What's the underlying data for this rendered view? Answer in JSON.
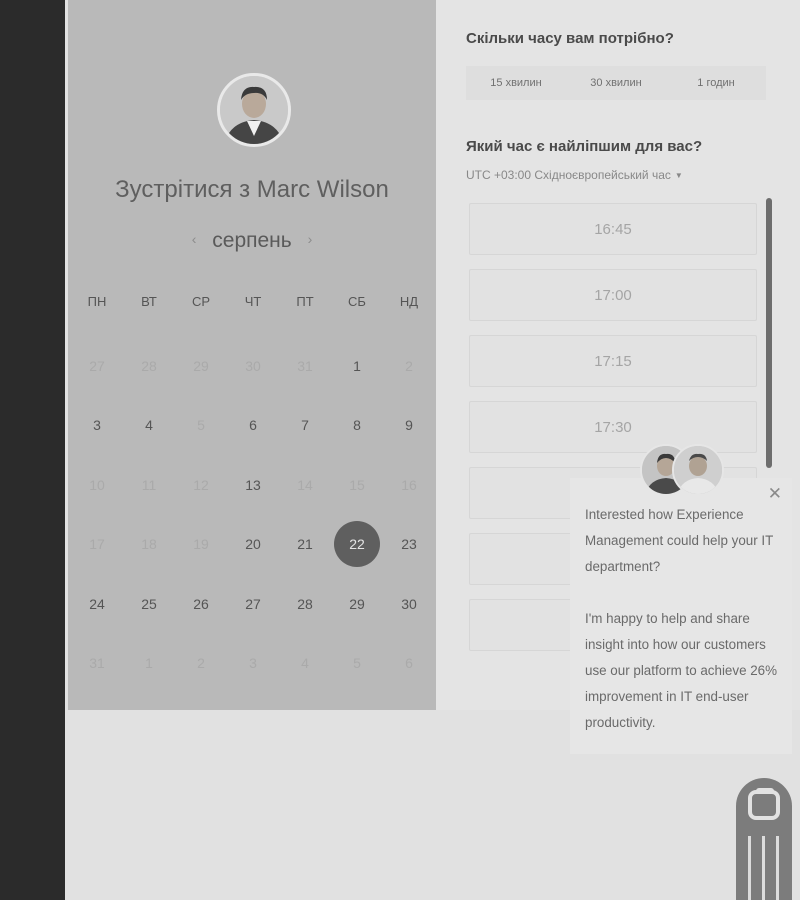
{
  "host": {
    "title": "Зустрітися з Marc Wilson"
  },
  "calendar": {
    "month": "серпень",
    "weekdays": [
      "ПН",
      "ВТ",
      "СР",
      "ЧТ",
      "ПТ",
      "СБ",
      "НД"
    ],
    "days": [
      {
        "label": "27",
        "state": "inactive"
      },
      {
        "label": "28",
        "state": "inactive"
      },
      {
        "label": "29",
        "state": "inactive"
      },
      {
        "label": "30",
        "state": "inactive"
      },
      {
        "label": "31",
        "state": "inactive"
      },
      {
        "label": "1",
        "state": "active"
      },
      {
        "label": "2",
        "state": "inactive"
      },
      {
        "label": "3",
        "state": "active"
      },
      {
        "label": "4",
        "state": "active"
      },
      {
        "label": "5",
        "state": "inactive"
      },
      {
        "label": "6",
        "state": "active"
      },
      {
        "label": "7",
        "state": "active"
      },
      {
        "label": "8",
        "state": "active"
      },
      {
        "label": "9",
        "state": "active"
      },
      {
        "label": "10",
        "state": "inactive"
      },
      {
        "label": "11",
        "state": "inactive"
      },
      {
        "label": "12",
        "state": "inactive"
      },
      {
        "label": "13",
        "state": "active"
      },
      {
        "label": "14",
        "state": "inactive"
      },
      {
        "label": "15",
        "state": "inactive"
      },
      {
        "label": "16",
        "state": "inactive"
      },
      {
        "label": "17",
        "state": "inactive"
      },
      {
        "label": "18",
        "state": "inactive"
      },
      {
        "label": "19",
        "state": "inactive"
      },
      {
        "label": "20",
        "state": "active"
      },
      {
        "label": "21",
        "state": "active"
      },
      {
        "label": "22",
        "state": "selected"
      },
      {
        "label": "23",
        "state": "active"
      },
      {
        "label": "24",
        "state": "active"
      },
      {
        "label": "25",
        "state": "active"
      },
      {
        "label": "26",
        "state": "active"
      },
      {
        "label": "27",
        "state": "active"
      },
      {
        "label": "28",
        "state": "active"
      },
      {
        "label": "29",
        "state": "active"
      },
      {
        "label": "30",
        "state": "active"
      },
      {
        "label": "31",
        "state": "inactive"
      },
      {
        "label": "1",
        "state": "inactive"
      },
      {
        "label": "2",
        "state": "inactive"
      },
      {
        "label": "3",
        "state": "inactive"
      },
      {
        "label": "4",
        "state": "inactive"
      },
      {
        "label": "5",
        "state": "inactive"
      },
      {
        "label": "6",
        "state": "inactive"
      }
    ]
  },
  "duration": {
    "question": "Скільки часу вам потрібно?",
    "options": [
      "15 хвилин",
      "30 хвилин",
      "1 годин"
    ]
  },
  "time": {
    "question": "Який час є найліпшим для вас?",
    "timezone": "UTC +03:00 Східноєвропейський час",
    "slots": [
      "16:45",
      "17:00",
      "17:15",
      "17:30",
      "",
      "",
      ""
    ]
  },
  "popup": {
    "message_1": "Interested how Experience Management could help your IT department?",
    "message_2": "I'm happy to help and share insight into how our customers use our platform to achieve 26% improvement in IT end-user productivity."
  },
  "icons": {
    "close": "close-icon",
    "prev": "chevron-left-icon",
    "next": "chevron-right-icon",
    "tz_caret": "caret-down-icon",
    "chat": "chat-launcher-icon"
  }
}
